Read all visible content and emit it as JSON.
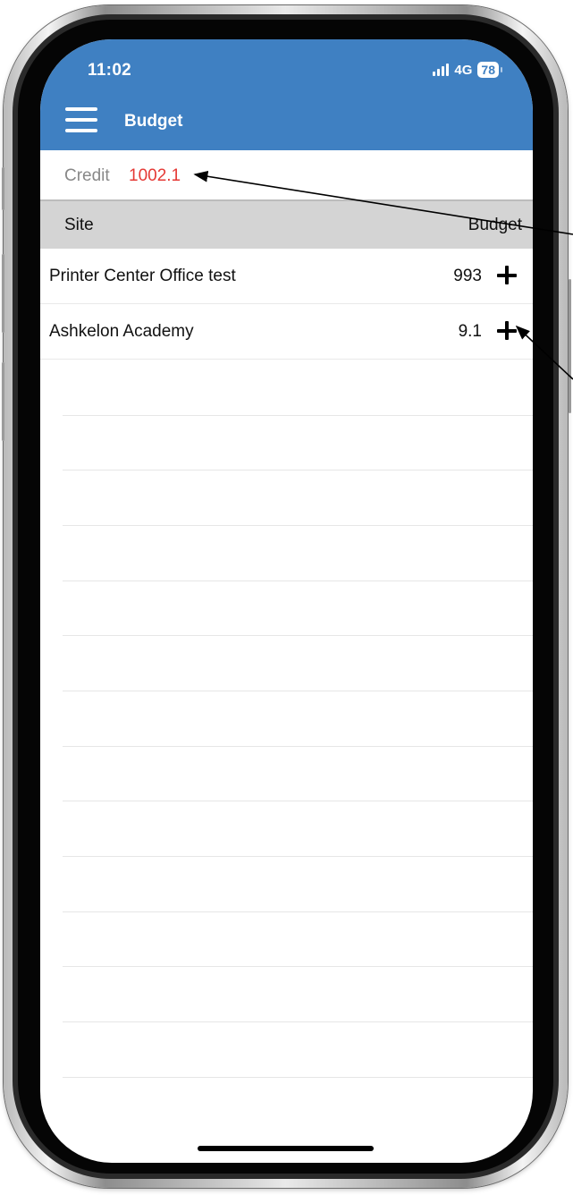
{
  "status_bar": {
    "time": "11:02",
    "network": "4G",
    "battery": "78"
  },
  "appbar": {
    "title": "Budget",
    "menu_icon": "hamburger-menu-icon"
  },
  "credit": {
    "label": "Credit",
    "value": "1002.1",
    "value_color": "#e53935"
  },
  "table": {
    "headers": {
      "site": "Site",
      "budget": "Budget"
    },
    "rows": [
      {
        "site": "Printer Center Office test",
        "budget": "993",
        "action_icon": "plus-icon"
      },
      {
        "site": "Ashkelon Academy",
        "budget": "9.1",
        "action_icon": "plus-icon"
      }
    ]
  },
  "colors": {
    "accent": "#3f80c2",
    "header_bg": "#d4d4d4"
  }
}
